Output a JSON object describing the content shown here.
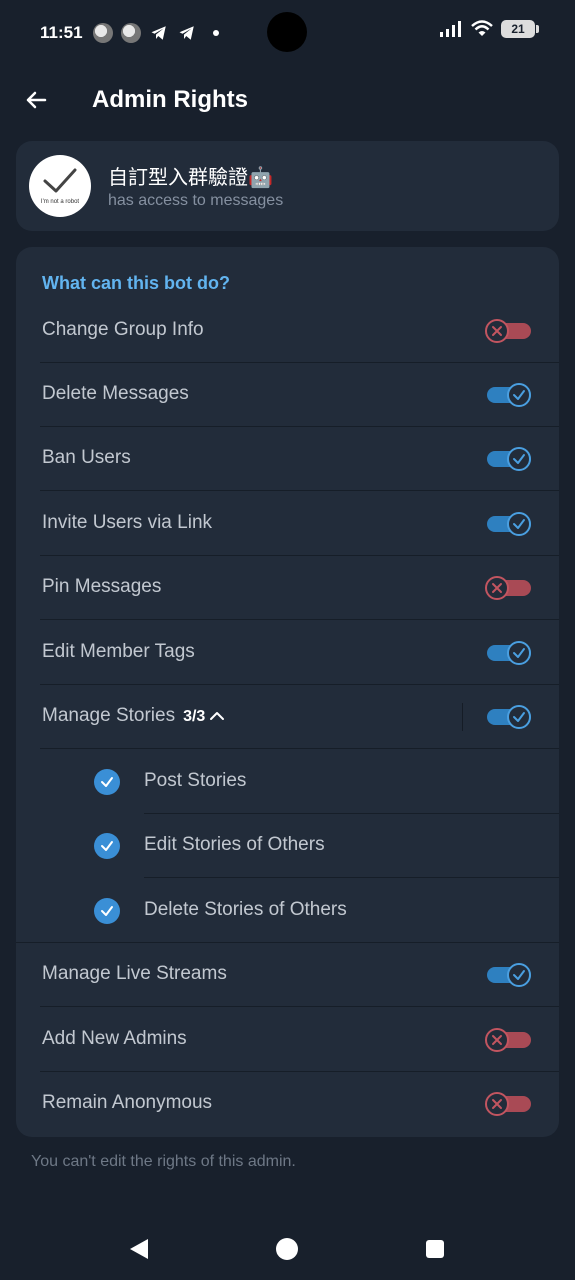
{
  "status_bar": {
    "time": "11:51",
    "battery": "21"
  },
  "header": {
    "title": "Admin Rights"
  },
  "bot": {
    "name": "自訂型入群驗證🤖",
    "status": "has access to messages",
    "avatar_text": "I'm not a robot"
  },
  "rights": {
    "section_title": "What can this bot do?",
    "items": [
      {
        "label": "Change Group Info",
        "enabled": false
      },
      {
        "label": "Delete Messages",
        "enabled": true
      },
      {
        "label": "Ban Users",
        "enabled": true
      },
      {
        "label": "Invite Users via Link",
        "enabled": true
      },
      {
        "label": "Pin Messages",
        "enabled": false
      },
      {
        "label": "Edit Member Tags",
        "enabled": true
      },
      {
        "label": "Manage Stories",
        "count": "3/3",
        "enabled": true
      },
      {
        "label": "Manage Live Streams",
        "enabled": true
      },
      {
        "label": "Add New Admins",
        "enabled": false
      },
      {
        "label": "Remain Anonymous",
        "enabled": false
      }
    ],
    "story_subitems": [
      {
        "label": "Post Stories",
        "checked": true
      },
      {
        "label": "Edit Stories of Others",
        "checked": true
      },
      {
        "label": "Delete Stories of Others",
        "checked": true
      }
    ]
  },
  "footer_note": "You can't edit the rights of this admin.",
  "colors": {
    "background": "#18202c",
    "card": "#222c3a",
    "accent": "#62b4ef",
    "toggle_on": "#2e80c0",
    "toggle_off": "#a94a55"
  }
}
